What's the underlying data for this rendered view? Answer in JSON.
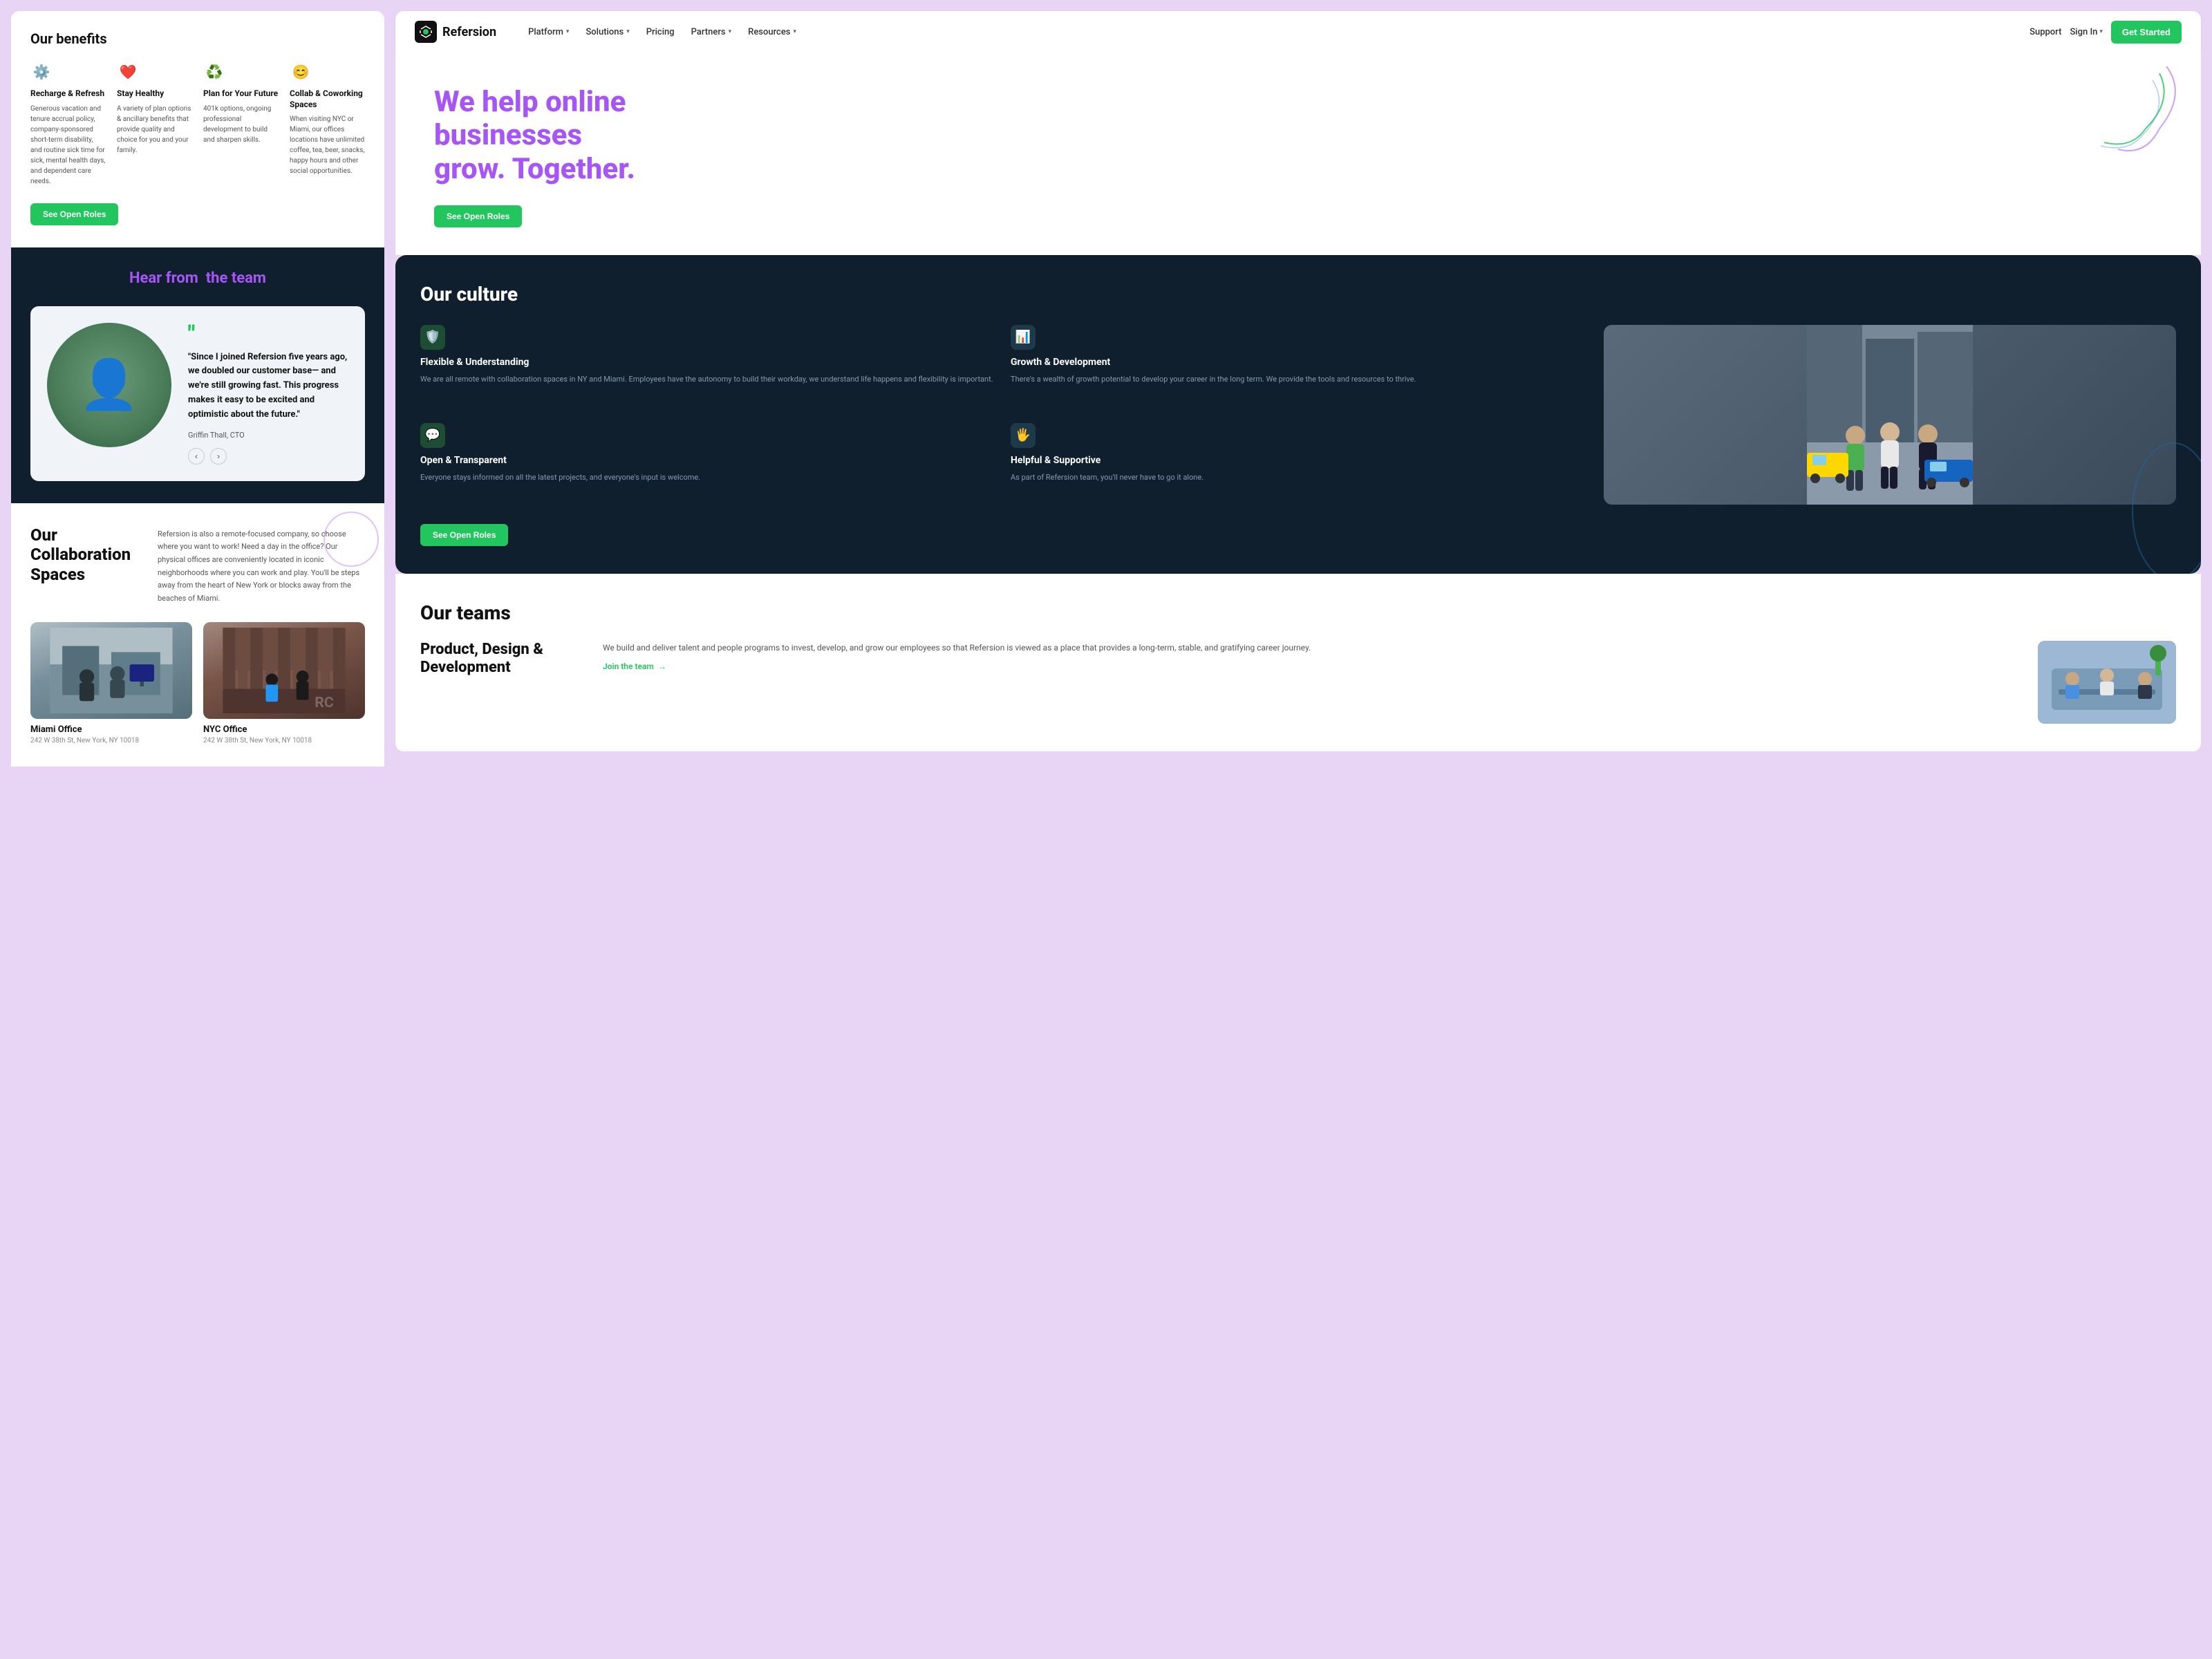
{
  "left": {
    "benefits": {
      "title": "Our benefits",
      "items": [
        {
          "icon": "⚙️",
          "name": "Recharge & Refresh",
          "desc": "Generous vacation and tenure accrual policy, company-sponsored short-term disability, and routine sick time for sick, mental health days, and dependent care needs."
        },
        {
          "icon": "❤️",
          "name": "Stay Healthy",
          "desc": "A variety of plan options & ancillary benefits that provide quality and choice for you and your family."
        },
        {
          "icon": "♻️",
          "name": "Plan for Your Future",
          "desc": "401k options, ongoing professional development to build and sharpen skills."
        },
        {
          "icon": "😊",
          "name": "Collab & Coworking Spaces",
          "desc": "When visiting NYC or Miami, our offices locations have unlimited coffee, tea, beer, snacks, happy hours and other social opportunities."
        }
      ],
      "cta_label": "See Open Roles"
    },
    "testimonial": {
      "title": "Hear from",
      "title_highlight": "the team",
      "quote": "\"Since I joined Refersion five years ago, we doubled our customer base— and we're still growing fast. This progress makes it easy to be excited and optimistic about the future.\"",
      "author": "Griffin Thall, CTO"
    },
    "collab": {
      "title": "Our Collaboration Spaces",
      "desc": "Refersion is also a remote-focused company, so choose where you want to work! Need a day in the office? Our physical offices are conveniently located in iconic neighborhoods where you can work and play. You'll be steps away from the heart of New York or blocks away from the beaches of Miami.",
      "offices": [
        {
          "name": "Miami Office",
          "address": "242 W 38th St, New York, NY 10018"
        },
        {
          "name": "NYC Office",
          "address": "242 W 38th St, New York, NY 10018"
        }
      ]
    }
  },
  "right": {
    "navbar": {
      "logo_text": "Refersion",
      "nav_items": [
        {
          "label": "Platform",
          "has_dropdown": true
        },
        {
          "label": "Solutions",
          "has_dropdown": true
        },
        {
          "label": "Pricing",
          "has_dropdown": false
        },
        {
          "label": "Partners",
          "has_dropdown": true
        },
        {
          "label": "Resources",
          "has_dropdown": true
        }
      ],
      "support_label": "Support",
      "signin_label": "Sign In",
      "cta_label": "Get Started"
    },
    "hero": {
      "headline_1": "We help online businesses",
      "headline_2": "grow.",
      "headline_highlight": "Together.",
      "cta_label": "See Open Roles"
    },
    "culture": {
      "title": "Our culture",
      "features": [
        {
          "icon": "🛡️",
          "name": "Flexible & Understanding",
          "desc": "We are all remote with collaboration spaces in NY and Miami. Employees have the autonomy to build their workday, we understand life happens and flexibility is important.",
          "icon_style": "green"
        },
        {
          "icon": "📊",
          "name": "Growth & Development",
          "desc": "There's a wealth of growth potential to develop your career in the long term. We provide the tools and resources to thrive.",
          "icon_style": "dark"
        },
        {
          "icon": "💬",
          "name": "Open & Transparent",
          "desc": "Everyone stays informed on all the latest projects, and everyone's input is welcome.",
          "icon_style": "green"
        },
        {
          "icon": "🖐️",
          "name": "Helpful & Supportive",
          "desc": "As part of Refersion team, you'll never have to go it alone.",
          "icon_style": "dark"
        }
      ],
      "cta_label": "See Open Roles"
    },
    "teams": {
      "title": "Our teams",
      "items": [
        {
          "name": "Product, Design & Development",
          "desc": "We build and deliver talent and people programs to invest, develop, and grow our employees so that Refersion is viewed as a place that provides a long-term, stable, and gratifying career journey.",
          "link_label": "Join the team",
          "link_arrow": "→"
        }
      ]
    }
  }
}
